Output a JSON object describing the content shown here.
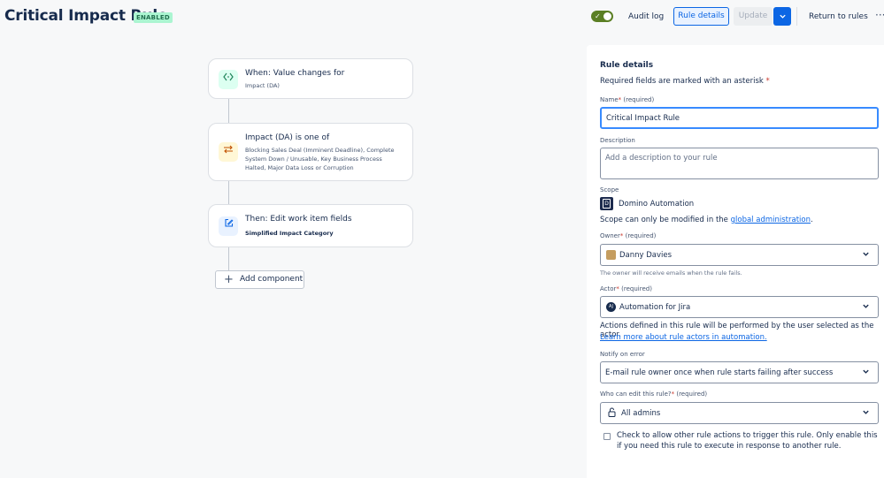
{
  "header": {
    "title": "Critical Impact Rule",
    "status": "ENABLED",
    "audit_log": "Audit log",
    "rule_details": "Rule details",
    "update": "Update",
    "return": "Return to rules",
    "more": "···"
  },
  "flow": {
    "trigger": {
      "title": "When: Value changes for",
      "subtitle": "Impact (DA)",
      "icon": "code-brackets-icon"
    },
    "condition": {
      "title": "Impact (DA) is one of",
      "subtitle": "Blocking Sales Deal (Imminent Deadline), Complete System Down / Unusable, Key Business Process Halted, Major Data Loss or Corruption",
      "icon": "swap-arrows-icon"
    },
    "action": {
      "title": "Then: Edit work item fields",
      "subtitle": "Simplified Impact Category",
      "icon": "edit-icon"
    },
    "add_component": "Add component"
  },
  "panel": {
    "heading": "Rule details",
    "required_note": "Required fields are marked with an asterisk",
    "asterisk": "*",
    "name_label": "Name",
    "required_suffix": "(required)",
    "name_value": "Critical Impact Rule",
    "description_label": "Description",
    "description_placeholder": "Add a description to your rule",
    "scope_label": "Scope",
    "scope_value": "Domino Automation",
    "scope_note_prefix": "Scope can only be modified in the ",
    "scope_note_link": "global administration",
    "scope_note_suffix": ".",
    "owner_label": "Owner",
    "owner_value": "Danny Davies",
    "owner_helper": "The owner will receive emails when the rule fails.",
    "actor_label": "Actor",
    "actor_value": "Automation for Jira",
    "actor_note": "Actions defined in this rule will be performed by the user selected as the actor.",
    "actor_link": "Learn more about rule actors in automation.",
    "notify_label": "Notify on error",
    "notify_value": "E-mail rule owner once when rule starts failing after success",
    "who_label": "Who can edit this rule?",
    "who_value": "All admins",
    "checkbox_text": "Check to allow other rule actions to trigger this rule. Only enable this if you need this rule to execute in response to another rule."
  },
  "colors": {
    "accent": "#0c66e4",
    "enabled_badge_bg": "#abf5d1",
    "toggle_on": "#5b7f24"
  }
}
